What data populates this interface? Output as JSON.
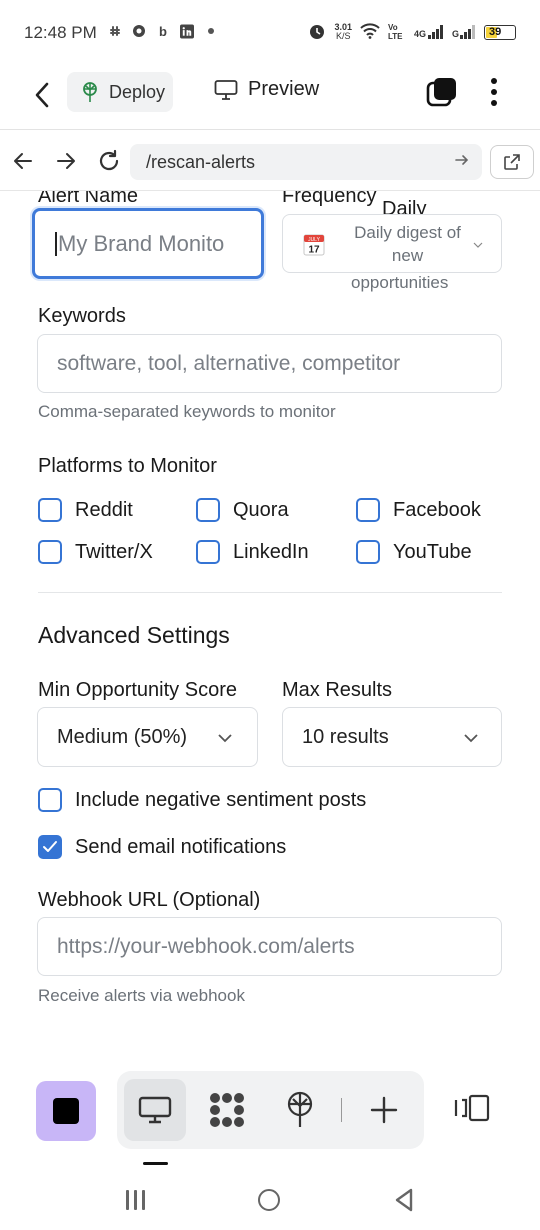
{
  "status_bar": {
    "time": "12:48 PM",
    "net_speed": "3.01",
    "net_unit": "K/S",
    "net_type": "4G",
    "lte_label": "Vo LTE",
    "g_label": "G",
    "battery": "39"
  },
  "app_bar": {
    "deploy_label": "Deploy",
    "preview_label": "Preview"
  },
  "browser": {
    "url": "/rescan-alerts"
  },
  "form": {
    "alert_name_label": "Alert Name",
    "alert_name_placeholder": "My Brand Monito",
    "frequency_label": "Frequency",
    "frequency_value": "Daily",
    "frequency_option_text": "Daily digest of new",
    "frequency_option_overflow": "opportunities",
    "calendar_month": "JULY",
    "calendar_day": "17",
    "keywords_label": "Keywords",
    "keywords_placeholder": "software, tool, alternative, competitor",
    "keywords_helper": "Comma-separated keywords to monitor",
    "platforms_label": "Platforms to Monitor",
    "platforms": [
      {
        "label": "Reddit",
        "checked": false
      },
      {
        "label": "Quora",
        "checked": false
      },
      {
        "label": "Facebook",
        "checked": false
      },
      {
        "label": "Twitter/X",
        "checked": false
      },
      {
        "label": "LinkedIn",
        "checked": false
      },
      {
        "label": "YouTube",
        "checked": false
      }
    ],
    "advanced_title": "Advanced Settings",
    "min_score_label": "Min Opportunity Score",
    "min_score_value": "Medium (50%)",
    "max_results_label": "Max Results",
    "max_results_value": "10 results",
    "negative_sentiment_label": "Include negative sentiment posts",
    "negative_sentiment_checked": false,
    "email_notifications_label": "Send email notifications",
    "email_notifications_checked": true,
    "webhook_label": "Webhook URL (Optional)",
    "webhook_placeholder": "https://your-webhook.com/alerts",
    "webhook_helper": "Receive alerts via webhook"
  },
  "colors": {
    "accent": "#3574d4",
    "focus_ring": "#3f7ad9",
    "stop_button": "#c8b6f7"
  },
  "icons": {
    "back": "chevron-left-icon",
    "deploy": "deploy-tree-icon",
    "preview": "monitor-icon",
    "tabs": "tabs-icon",
    "menu": "more-vertical-icon",
    "nav_back": "arrow-left-icon",
    "nav_forward": "arrow-right-icon",
    "reload": "reload-icon",
    "external": "external-link-icon"
  }
}
